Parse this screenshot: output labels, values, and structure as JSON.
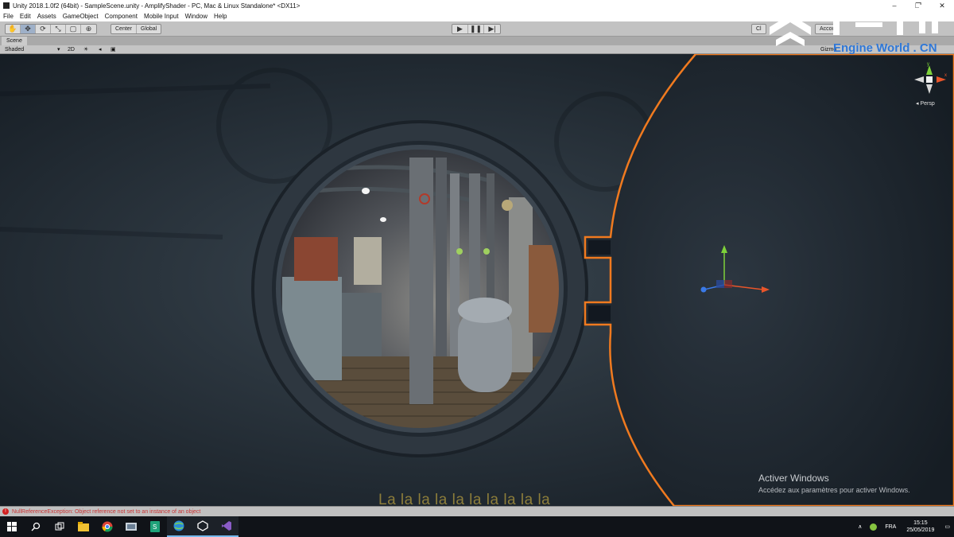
{
  "window": {
    "title": "Unity 2018.1.0f2 (64bit) - SampleScene.unity - AmplifyShader - PC, Mac & Linux Standalone* <DX11>",
    "controls": [
      "–",
      "❐",
      "✕"
    ]
  },
  "menu": [
    "File",
    "Edit",
    "Assets",
    "GameObject",
    "Component",
    "Mobile Input",
    "Window",
    "Help"
  ],
  "toolbar": {
    "pivot_center": "Center",
    "pivot_global": "Global",
    "right_buttons": [
      "Cl",
      "Accou"
    ]
  },
  "scene": {
    "tab_label": "Scene",
    "draw_mode": "Shaded",
    "mode_2d": "2D",
    "gizmo_label": "Gizmo",
    "persp_label": "Persp"
  },
  "watermark": {
    "text": "Engine World . CN",
    "brand_color": "#2f78d8"
  },
  "overlay": {
    "activate_title": "Activer Windows",
    "activate_sub": "Accédez aux paramètres pour activer Windows.",
    "lyrics": "La la la la la la la la la la"
  },
  "status": {
    "error_message": "NullReferenceException: Object reference not set to an instance of an object"
  },
  "taskbar": {
    "apps": [
      "windows-start",
      "search",
      "task-view",
      "file-explorer",
      "chrome",
      "files",
      "green-app",
      "browser",
      "unity",
      "visual-studio"
    ],
    "tray_lang": "FRA",
    "time": "15:15",
    "date": "25/05/2019"
  },
  "colors": {
    "selection_outline": "#f07a1f",
    "axis_x": "#e8552a",
    "axis_y": "#7ed23a",
    "axis_z": "#3a7ae8"
  }
}
